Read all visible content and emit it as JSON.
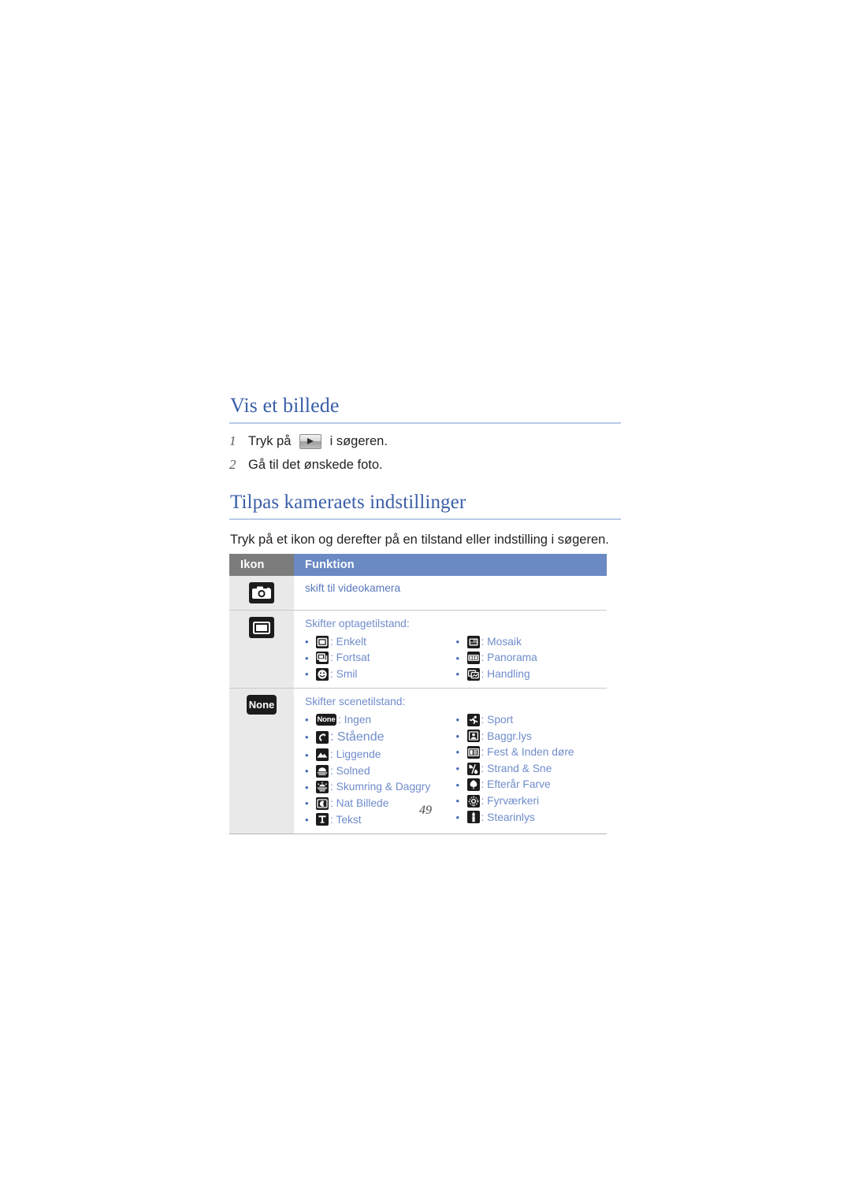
{
  "document": {
    "page_number": "49"
  },
  "sections": [
    {
      "heading": "Vis et billede",
      "steps": [
        {
          "num": "1",
          "text_before": "Tryk på ",
          "icon": "play-icon",
          "text_after": " i søgeren."
        },
        {
          "num": "2",
          "text_before": "Gå til det ønskede foto.",
          "icon": null,
          "text_after": ""
        }
      ]
    },
    {
      "heading": "Tilpas kameraets indstillinger",
      "intro": "Tryk på et ikon og derefter på en tilstand eller indstilling i søgeren."
    }
  ],
  "table": {
    "columns": [
      "Ikon",
      "Funktion"
    ],
    "rows": [
      {
        "icon": "camera-icon",
        "description": "skift til videokamera",
        "groups": []
      },
      {
        "icon": "single-shot-icon",
        "description": "Skifter optagetilstand:",
        "left": [
          {
            "icon": "single-icon",
            "label": "Enkelt"
          },
          {
            "icon": "continuous-icon",
            "label": "Fortsat"
          },
          {
            "icon": "smile-icon",
            "label": "Smil"
          }
        ],
        "right": [
          {
            "icon": "mosaic-icon",
            "label": "Mosaik"
          },
          {
            "icon": "panorama-icon",
            "label": "Panorama"
          },
          {
            "icon": "action-icon",
            "label": "Handling"
          }
        ]
      },
      {
        "icon": "none-icon",
        "description": "Skifter scenetilstand:",
        "left": [
          {
            "icon": "none-small-icon",
            "label": "Ingen"
          },
          {
            "icon": "portrait-icon",
            "label": "Stående"
          },
          {
            "icon": "landscape-icon",
            "label": "Liggende"
          },
          {
            "icon": "sunset-icon",
            "label": "Solned"
          },
          {
            "icon": "dawn-icon",
            "label": "Skumring & Daggry"
          },
          {
            "icon": "night-icon",
            "label": "Nat Billede"
          },
          {
            "icon": "text-icon",
            "label": "Tekst"
          }
        ],
        "right": [
          {
            "icon": "sports-icon",
            "label": "Sport"
          },
          {
            "icon": "backlight-icon",
            "label": "Baggr.lys"
          },
          {
            "icon": "party-indoor-icon",
            "label": "Fest & Inden døre"
          },
          {
            "icon": "beach-snow-icon",
            "label": "Strand & Sne"
          },
          {
            "icon": "fall-color-icon",
            "label": "Efterår Farve"
          },
          {
            "icon": "firework-icon",
            "label": "Fyrværkeri"
          },
          {
            "icon": "candlelight-icon",
            "label": "Stearinlys"
          }
        ]
      }
    ]
  },
  "labels": {
    "none_text": "None",
    "separator": ": ",
    "bullet": "•"
  },
  "colors": {
    "heading": "#3a5fa8",
    "heading_rule": "#b9cbe6",
    "table_header_icon": "#7c7c7c",
    "table_header_func": "#6b8ac4",
    "link_text": "#6f8ccb",
    "icon_bg": "#1c1c1c",
    "icon_cell_bg": "#e9e9e9",
    "body_text": "#231f20"
  }
}
